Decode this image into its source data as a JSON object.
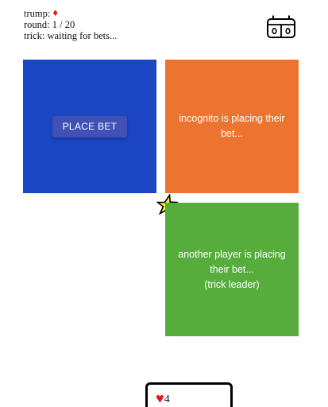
{
  "status": {
    "trump_label": "trump:",
    "trump_suit": "♦",
    "round_label": "round:",
    "round_value": "1 / 20",
    "trick_label": "trick:",
    "trick_value": "waiting for bets..."
  },
  "score_button": {
    "icon": "scoreboard-icon"
  },
  "panels": {
    "self": {
      "button_label": "PLACE BET",
      "color": "#1a46c3"
    },
    "opponent1": {
      "text": "incognito is placing their bet...",
      "color": "#ec7431"
    },
    "opponent2": {
      "line1": "another player is placing their bet...",
      "line2": "(trick leader)",
      "color": "#56ad3c"
    }
  },
  "leader_marker": {
    "icon": "star-icon",
    "color": "#f5ee3a"
  },
  "hand": {
    "cards": [
      {
        "suit": "♥",
        "rank": "4",
        "suit_color": "#e8141e"
      }
    ]
  }
}
